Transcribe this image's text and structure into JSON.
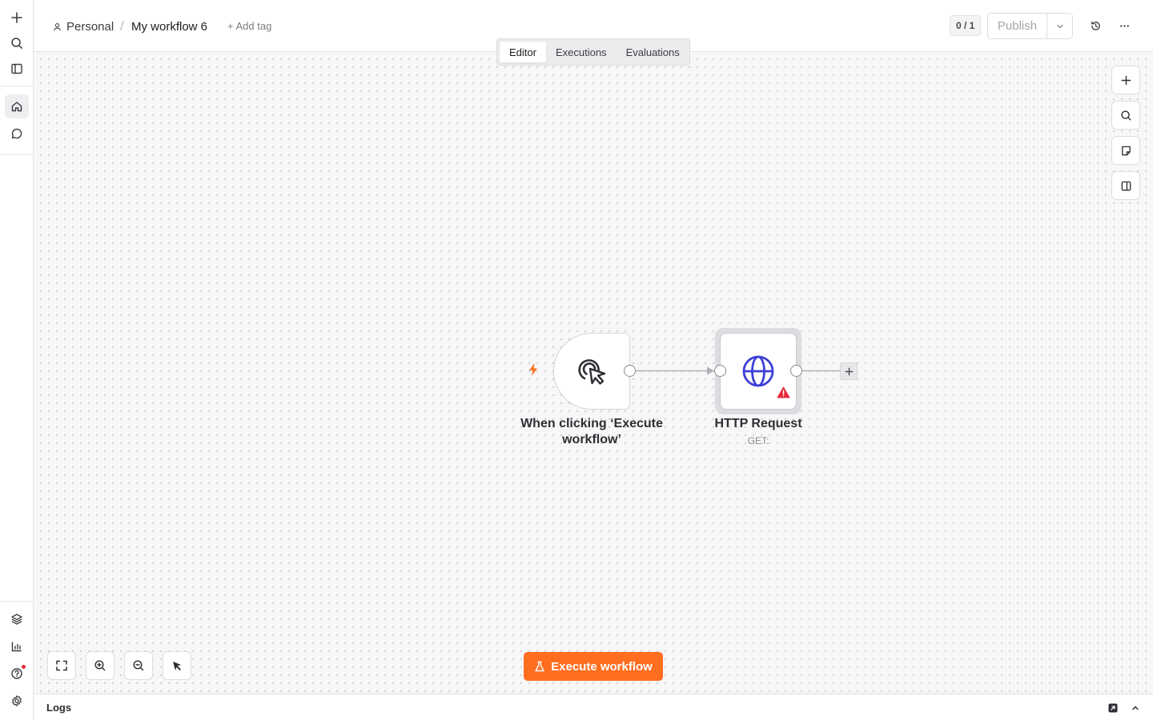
{
  "breadcrumb": {
    "project": "Personal",
    "separator": "/",
    "workflow_name": "My workflow 6",
    "add_tag": "+ Add tag"
  },
  "header": {
    "counter": "0 / 1",
    "publish_label": "Publish"
  },
  "tabs": [
    {
      "label": "Editor",
      "active": true
    },
    {
      "label": "Executions",
      "active": false
    },
    {
      "label": "Evaluations",
      "active": false
    }
  ],
  "nodes": {
    "trigger": {
      "title": "When clicking ‘Execute workflow’",
      "icon": "cursor-click-icon"
    },
    "http": {
      "title": "HTTP Request",
      "subtitle": "GET:",
      "icon": "globe-icon",
      "warning": true
    }
  },
  "actions": {
    "execute_label": "Execute workflow"
  },
  "logs": {
    "label": "Logs"
  },
  "colors": {
    "accent": "#ff6d1f",
    "http_icon": "#3c3fd6",
    "warning": "#e5293a"
  }
}
